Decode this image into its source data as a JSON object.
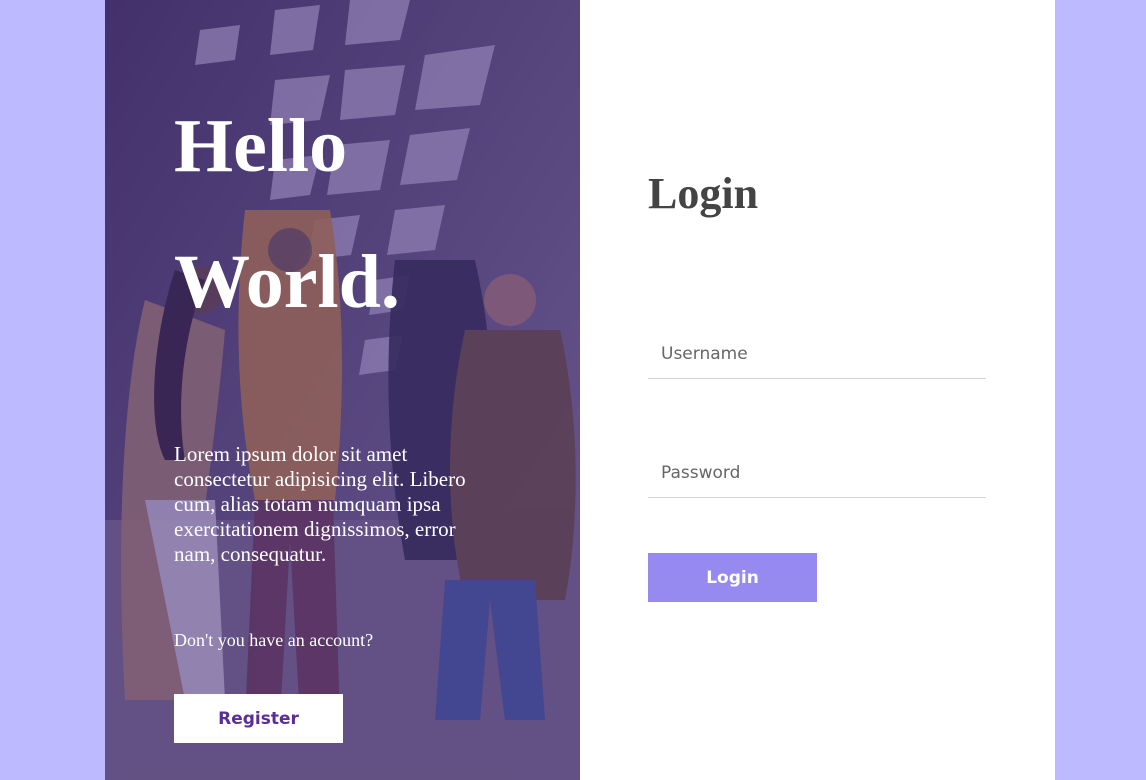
{
  "colors": {
    "page_bg": "#bebaff",
    "overlay": "#462d82",
    "register_text": "#5b2d96",
    "login_button_bg": "#968af0",
    "title_text": "#444444"
  },
  "left_panel": {
    "hello_line1": "Hello",
    "hello_line2": "World.",
    "description": "Lorem ipsum dolor sit amet consectetur adipisicing elit. Libero cum, alias totam numquam ipsa exercitationem dignissimos, error nam, consequatur.",
    "no_account": "Don't you have an account?",
    "register_label": "Register"
  },
  "right_panel": {
    "title": "Login",
    "username_placeholder": "Username",
    "password_placeholder": "Password",
    "login_label": "Login"
  }
}
